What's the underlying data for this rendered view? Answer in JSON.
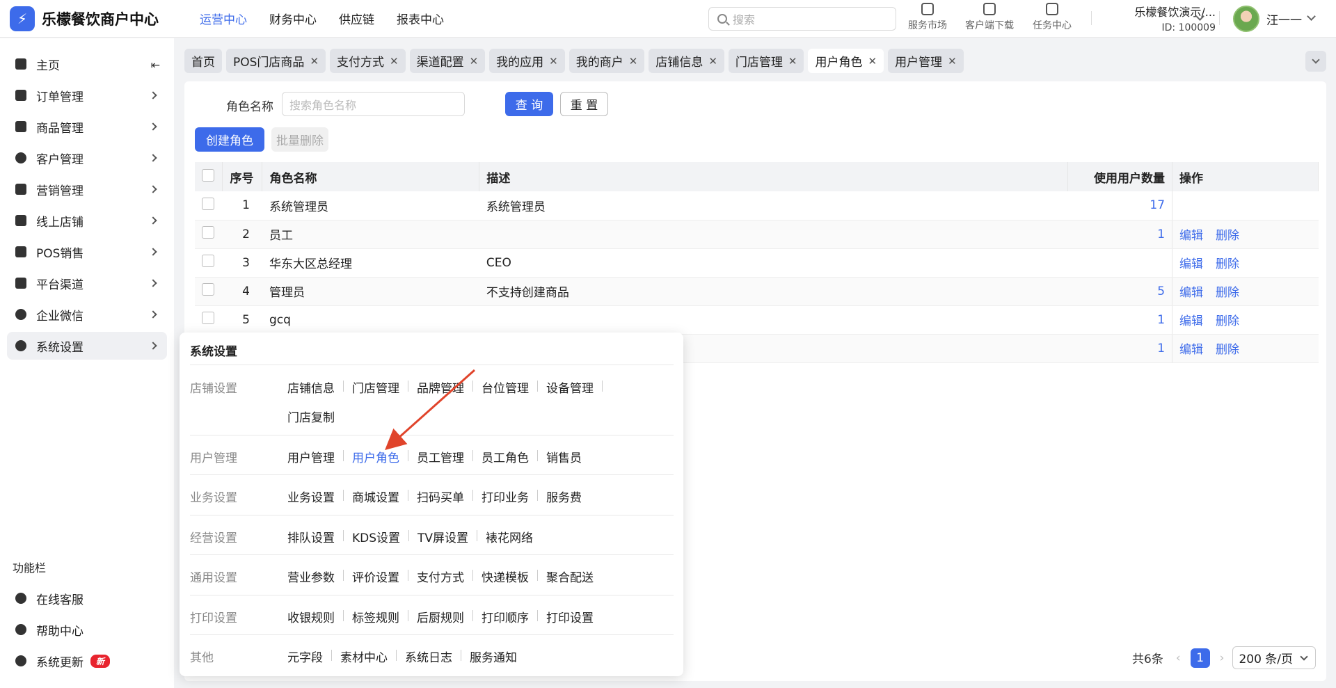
{
  "header": {
    "logo_text": "乐檬餐饮商户中心",
    "nav": [
      "运营中心",
      "财务中心",
      "供应链",
      "报表中心"
    ],
    "active_nav": "运营中心",
    "search_placeholder": "搜索",
    "tools": [
      "服务市场",
      "客户端下载",
      "任务中心"
    ],
    "merchant_name": "乐檬餐饮演示/...",
    "merchant_id": "ID: 100009",
    "user_name": "汪一一"
  },
  "sidebar": {
    "items": [
      "主页",
      "订单管理",
      "商品管理",
      "客户管理",
      "营销管理",
      "线上店铺",
      "POS销售",
      "平台渠道",
      "企业微信",
      "系统设置"
    ],
    "active": "系统设置",
    "func_title": "功能栏",
    "func_items": [
      "在线客服",
      "帮助中心",
      "系统更新"
    ],
    "new_badge": "新"
  },
  "tabs": [
    "首页",
    "POS门店商品",
    "支付方式",
    "渠道配置",
    "我的应用",
    "我的商户",
    "店铺信息",
    "门店管理",
    "用户角色",
    "用户管理"
  ],
  "active_tab": "用户角色",
  "filter": {
    "label": "角色名称",
    "placeholder": "搜索角色名称",
    "query_btn": "查 询",
    "reset_btn": "重 置"
  },
  "actions": {
    "create": "创建角色",
    "batch_delete": "批量删除"
  },
  "table": {
    "headers": [
      "序号",
      "角色名称",
      "描述",
      "使用用户数量",
      "操作"
    ],
    "edit_label": "编辑",
    "delete_label": "删除",
    "rows": [
      {
        "no": "1",
        "name": "系统管理员",
        "desc": "系统管理员",
        "count": "17"
      },
      {
        "no": "2",
        "name": "员工",
        "desc": "",
        "count": "1"
      },
      {
        "no": "3",
        "name": "华东大区总经理",
        "desc": "CEO",
        "count": ""
      },
      {
        "no": "4",
        "name": "管理员",
        "desc": "不支持创建商品",
        "count": "5"
      },
      {
        "no": "5",
        "name": "gcq",
        "desc": "",
        "count": "1"
      },
      {
        "no": "",
        "name": "",
        "desc": "",
        "count": "1"
      }
    ]
  },
  "pager": {
    "total": "共6条",
    "page": "1",
    "page_size": "200 条/页"
  },
  "popup": {
    "title": "系统设置",
    "active_item": "用户角色",
    "sections": [
      {
        "category": "店铺设置",
        "rows": [
          [
            "店铺信息",
            "门店管理",
            "品牌管理",
            "台位管理",
            "设备管理"
          ],
          [
            "门店复制"
          ]
        ]
      },
      {
        "category": "用户管理",
        "rows": [
          [
            "用户管理",
            "用户角色",
            "员工管理",
            "员工角色",
            "销售员"
          ]
        ]
      },
      {
        "category": "业务设置",
        "rows": [
          [
            "业务设置",
            "商城设置",
            "扫码买单",
            "打印业务",
            "服务费"
          ]
        ]
      },
      {
        "category": "经营设置",
        "rows": [
          [
            "排队设置",
            "KDS设置",
            "TV屏设置",
            "裱花网络"
          ]
        ]
      },
      {
        "category": "通用设置",
        "rows": [
          [
            "营业参数",
            "评价设置",
            "支付方式",
            "快递模板",
            "聚合配送"
          ]
        ]
      },
      {
        "category": "打印设置",
        "rows": [
          [
            "收银规则",
            "标签规则",
            "后厨规则",
            "打印顺序",
            "打印设置"
          ]
        ]
      },
      {
        "category": "其他",
        "rows": [
          [
            "元字段",
            "素材中心",
            "系统日志",
            "服务通知"
          ]
        ]
      }
    ]
  },
  "colors": {
    "accent": "#3d6bea",
    "annotation_arrow": "#e0442b",
    "badge": "#e8242e"
  }
}
